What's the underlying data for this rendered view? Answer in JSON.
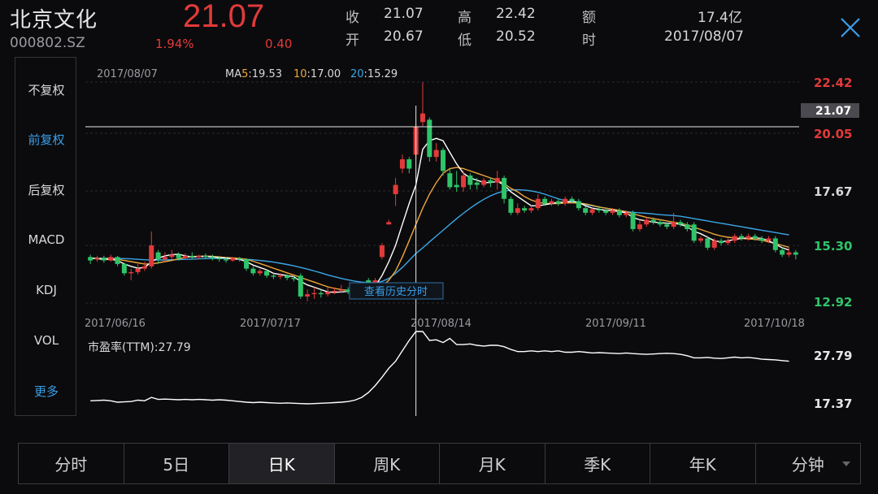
{
  "header": {
    "name": "北京文化",
    "code": "000802.SZ",
    "price": "21.07",
    "change_pct": "1.94%",
    "change_abs": "0.40",
    "quote": [
      {
        "label": "收",
        "value": "21.07"
      },
      {
        "label": "高",
        "value": "22.42"
      },
      {
        "label": "额",
        "value": "17.4亿"
      },
      {
        "label": "开",
        "value": "20.67"
      },
      {
        "label": "低",
        "value": "20.52"
      },
      {
        "label": "时",
        "value": "2017/08/07"
      }
    ]
  },
  "side_panel": {
    "items": [
      "不复权",
      "前复权",
      "后复权",
      "MACD",
      "KDJ",
      "VOL",
      "更多"
    ],
    "active_index": 1
  },
  "kline": {
    "date": "2017/08/07",
    "ma": {
      "label": "MA",
      "ma5_period": "5",
      "ma5_value": ":19.53",
      "ma10_period": "10",
      "ma10_value": ":17.00",
      "ma20_period": "20",
      "ma20_value": ":15.29"
    },
    "price_axis": [
      "22.42",
      "20.05",
      "17.67",
      "15.30",
      "12.92"
    ],
    "crosshair_price": "21.07",
    "date_axis": [
      "2017/06/16",
      "2017/07/17",
      "2017/08/14",
      "2017/09/11",
      "2017/10/18"
    ],
    "history_button": "查看历史分时"
  },
  "pe": {
    "label": "市盈率(TTM):27.79",
    "axis": [
      "27.79",
      "17.37"
    ]
  },
  "tabs": {
    "items": [
      "分时",
      "5日",
      "日K",
      "周K",
      "月K",
      "季K",
      "年K",
      "分钟"
    ],
    "active_index": 2
  },
  "colors": {
    "up": "#e23a3a",
    "down": "#2fc46a",
    "ma5": "#ffffff",
    "ma10": "#f0a63a",
    "ma20": "#3aa6e6",
    "accent": "#3a9ee8"
  },
  "chart_data": {
    "type": "candlestick",
    "price_range": [
      12.92,
      22.42
    ],
    "candles": [
      {
        "o": 14.9,
        "c": 14.75,
        "h": 15.0,
        "l": 14.6
      },
      {
        "o": 14.8,
        "c": 14.85,
        "h": 14.95,
        "l": 14.7
      },
      {
        "o": 14.85,
        "c": 14.75,
        "h": 14.95,
        "l": 14.65
      },
      {
        "o": 14.75,
        "c": 14.9,
        "h": 15.0,
        "l": 14.7
      },
      {
        "o": 14.9,
        "c": 14.6,
        "h": 14.95,
        "l": 14.5
      },
      {
        "o": 14.6,
        "c": 14.2,
        "h": 14.65,
        "l": 14.1
      },
      {
        "o": 14.2,
        "c": 14.25,
        "h": 14.4,
        "l": 13.9
      },
      {
        "o": 14.25,
        "c": 14.4,
        "h": 14.6,
        "l": 14.15
      },
      {
        "o": 14.4,
        "c": 14.5,
        "h": 14.7,
        "l": 14.3
      },
      {
        "o": 14.5,
        "c": 15.4,
        "h": 16.0,
        "l": 14.4
      },
      {
        "o": 15.1,
        "c": 14.8,
        "h": 15.2,
        "l": 14.6
      },
      {
        "o": 14.8,
        "c": 14.9,
        "h": 15.1,
        "l": 14.7
      },
      {
        "o": 14.9,
        "c": 15.0,
        "h": 15.2,
        "l": 14.8
      },
      {
        "o": 15.0,
        "c": 14.85,
        "h": 15.1,
        "l": 14.75
      },
      {
        "o": 14.85,
        "c": 14.95,
        "h": 15.05,
        "l": 14.8
      },
      {
        "o": 14.95,
        "c": 14.9,
        "h": 15.1,
        "l": 14.8
      },
      {
        "o": 14.9,
        "c": 14.95,
        "h": 15.0,
        "l": 14.8
      },
      {
        "o": 14.95,
        "c": 14.9,
        "h": 15.05,
        "l": 14.8
      },
      {
        "o": 14.9,
        "c": 14.85,
        "h": 15.0,
        "l": 14.75
      },
      {
        "o": 14.85,
        "c": 14.8,
        "h": 14.95,
        "l": 14.7
      },
      {
        "o": 14.8,
        "c": 14.75,
        "h": 14.9,
        "l": 14.65
      },
      {
        "o": 14.75,
        "c": 14.85,
        "h": 14.9,
        "l": 14.7
      },
      {
        "o": 14.85,
        "c": 14.8,
        "h": 14.9,
        "l": 14.7
      },
      {
        "o": 14.8,
        "c": 14.4,
        "h": 14.85,
        "l": 14.3
      },
      {
        "o": 14.4,
        "c": 14.2,
        "h": 14.5,
        "l": 14.1
      },
      {
        "o": 14.2,
        "c": 14.3,
        "h": 14.4,
        "l": 14.1
      },
      {
        "o": 14.3,
        "c": 14.1,
        "h": 14.35,
        "l": 14.0
      },
      {
        "o": 14.1,
        "c": 14.05,
        "h": 14.2,
        "l": 13.95
      },
      {
        "o": 14.05,
        "c": 14.1,
        "h": 14.2,
        "l": 13.95
      },
      {
        "o": 14.1,
        "c": 14.0,
        "h": 14.15,
        "l": 13.9
      },
      {
        "o": 14.0,
        "c": 13.95,
        "h": 14.1,
        "l": 13.85
      },
      {
        "o": 14.1,
        "c": 13.2,
        "h": 14.2,
        "l": 13.1
      },
      {
        "o": 13.2,
        "c": 13.3,
        "h": 13.5,
        "l": 13.0
      },
      {
        "o": 13.3,
        "c": 13.35,
        "h": 13.6,
        "l": 13.1
      },
      {
        "o": 13.35,
        "c": 13.3,
        "h": 13.5,
        "l": 13.15
      },
      {
        "o": 13.3,
        "c": 13.4,
        "h": 13.6,
        "l": 13.2
      },
      {
        "o": 13.4,
        "c": 13.45,
        "h": 13.6,
        "l": 13.3
      },
      {
        "o": 13.45,
        "c": 13.5,
        "h": 13.7,
        "l": 13.35
      },
      {
        "o": 13.5,
        "c": 13.4,
        "h": 13.6,
        "l": 13.3
      },
      {
        "o": 13.4,
        "c": 13.5,
        "h": 13.65,
        "l": 13.3
      },
      {
        "o": 13.5,
        "c": 13.45,
        "h": 13.6,
        "l": 13.35
      },
      {
        "o": 13.9,
        "c": 13.6,
        "h": 14.0,
        "l": 13.5
      },
      {
        "o": 13.6,
        "c": 13.9,
        "h": 14.0,
        "l": 13.5
      },
      {
        "o": 14.9,
        "c": 15.4,
        "h": 15.5,
        "l": 14.8
      },
      {
        "o": 16.3,
        "c": 16.4,
        "h": 16.5,
        "l": 16.3
      },
      {
        "o": 17.6,
        "c": 18.0,
        "h": 18.3,
        "l": 17.1
      },
      {
        "o": 18.7,
        "c": 19.1,
        "h": 19.3,
        "l": 18.5
      },
      {
        "o": 19.1,
        "c": 18.7,
        "h": 19.2,
        "l": 18.5
      },
      {
        "o": 19.3,
        "c": 20.5,
        "h": 20.6,
        "l": 19.1
      },
      {
        "o": 20.7,
        "c": 21.07,
        "h": 22.42,
        "l": 20.52
      },
      {
        "o": 20.8,
        "c": 19.2,
        "h": 20.9,
        "l": 19.0
      },
      {
        "o": 19.2,
        "c": 19.5,
        "h": 19.8,
        "l": 19.0
      },
      {
        "o": 19.5,
        "c": 18.6,
        "h": 19.6,
        "l": 18.4
      },
      {
        "o": 18.5,
        "c": 17.9,
        "h": 18.7,
        "l": 17.8
      },
      {
        "o": 18.0,
        "c": 17.9,
        "h": 18.6,
        "l": 17.7
      },
      {
        "o": 17.9,
        "c": 18.4,
        "h": 18.6,
        "l": 17.7
      },
      {
        "o": 18.4,
        "c": 18.0,
        "h": 18.5,
        "l": 17.8
      },
      {
        "o": 18.1,
        "c": 18.0,
        "h": 18.3,
        "l": 17.8
      },
      {
        "o": 18.0,
        "c": 18.2,
        "h": 18.3,
        "l": 17.9
      },
      {
        "o": 18.2,
        "c": 18.1,
        "h": 18.3,
        "l": 17.9
      },
      {
        "o": 18.1,
        "c": 18.3,
        "h": 18.6,
        "l": 17.8
      },
      {
        "o": 18.3,
        "c": 17.4,
        "h": 18.4,
        "l": 17.2
      },
      {
        "o": 17.4,
        "c": 16.8,
        "h": 17.5,
        "l": 16.7
      },
      {
        "o": 16.8,
        "c": 17.0,
        "h": 17.2,
        "l": 16.7
      },
      {
        "o": 17.0,
        "c": 16.9,
        "h": 17.1,
        "l": 16.8
      },
      {
        "o": 16.9,
        "c": 17.0,
        "h": 17.1,
        "l": 16.8
      },
      {
        "o": 17.0,
        "c": 17.4,
        "h": 17.6,
        "l": 16.9
      },
      {
        "o": 17.4,
        "c": 17.2,
        "h": 17.5,
        "l": 17.1
      },
      {
        "o": 17.2,
        "c": 17.3,
        "h": 17.4,
        "l": 17.1
      },
      {
        "o": 17.3,
        "c": 17.2,
        "h": 17.4,
        "l": 17.1
      },
      {
        "o": 17.2,
        "c": 17.4,
        "h": 17.5,
        "l": 17.1
      },
      {
        "o": 17.4,
        "c": 17.3,
        "h": 17.5,
        "l": 17.2
      },
      {
        "o": 17.3,
        "c": 17.0,
        "h": 17.4,
        "l": 16.9
      },
      {
        "o": 17.0,
        "c": 16.8,
        "h": 17.1,
        "l": 16.7
      },
      {
        "o": 16.8,
        "c": 16.95,
        "h": 17.0,
        "l": 16.7
      },
      {
        "o": 16.95,
        "c": 16.9,
        "h": 17.1,
        "l": 16.8
      },
      {
        "o": 16.9,
        "c": 16.8,
        "h": 17.0,
        "l": 16.7
      },
      {
        "o": 16.8,
        "c": 16.9,
        "h": 17.0,
        "l": 16.7
      },
      {
        "o": 16.9,
        "c": 16.7,
        "h": 17.0,
        "l": 16.6
      },
      {
        "o": 16.7,
        "c": 16.8,
        "h": 16.9,
        "l": 16.6
      },
      {
        "o": 16.8,
        "c": 16.1,
        "h": 16.9,
        "l": 16.0
      },
      {
        "o": 16.1,
        "c": 16.3,
        "h": 16.5,
        "l": 16.0
      },
      {
        "o": 16.3,
        "c": 16.5,
        "h": 16.6,
        "l": 16.2
      },
      {
        "o": 16.5,
        "c": 16.4,
        "h": 16.6,
        "l": 16.3
      },
      {
        "o": 16.4,
        "c": 16.3,
        "h": 16.5,
        "l": 16.2
      },
      {
        "o": 16.3,
        "c": 16.2,
        "h": 16.4,
        "l": 16.1
      },
      {
        "o": 16.2,
        "c": 16.4,
        "h": 16.8,
        "l": 16.1
      },
      {
        "o": 16.4,
        "c": 16.3,
        "h": 16.5,
        "l": 16.2
      },
      {
        "o": 16.3,
        "c": 16.1,
        "h": 16.4,
        "l": 16.0
      },
      {
        "o": 16.3,
        "c": 15.6,
        "h": 16.4,
        "l": 15.5
      },
      {
        "o": 15.6,
        "c": 15.7,
        "h": 15.8,
        "l": 15.5
      },
      {
        "o": 15.7,
        "c": 15.3,
        "h": 15.8,
        "l": 15.2
      },
      {
        "o": 15.3,
        "c": 15.6,
        "h": 15.7,
        "l": 15.2
      },
      {
        "o": 15.6,
        "c": 15.5,
        "h": 15.7,
        "l": 15.4
      },
      {
        "o": 15.5,
        "c": 15.6,
        "h": 15.7,
        "l": 15.4
      },
      {
        "o": 15.6,
        "c": 15.8,
        "h": 15.9,
        "l": 15.5
      },
      {
        "o": 15.8,
        "c": 15.7,
        "h": 15.9,
        "l": 15.6
      },
      {
        "o": 15.7,
        "c": 15.8,
        "h": 15.9,
        "l": 15.6
      },
      {
        "o": 15.8,
        "c": 15.7,
        "h": 15.9,
        "l": 15.6
      },
      {
        "o": 15.7,
        "c": 15.6,
        "h": 15.8,
        "l": 15.5
      },
      {
        "o": 15.6,
        "c": 15.7,
        "h": 15.8,
        "l": 15.5
      },
      {
        "o": 15.7,
        "c": 15.2,
        "h": 15.8,
        "l": 15.1
      },
      {
        "o": 15.2,
        "c": 15.0,
        "h": 15.3,
        "l": 14.9
      },
      {
        "o": 15.0,
        "c": 15.1,
        "h": 15.3,
        "l": 14.9
      },
      {
        "o": 15.1,
        "c": 15.0,
        "h": 15.2,
        "l": 14.8
      }
    ],
    "ma5": [
      14.85,
      14.82,
      14.8,
      14.8,
      14.75,
      14.6,
      14.5,
      14.42,
      14.45,
      14.7,
      14.85,
      14.95,
      15.0,
      15.02,
      14.95,
      14.9,
      14.92,
      14.93,
      14.9,
      14.88,
      14.85,
      14.82,
      14.8,
      14.7,
      14.55,
      14.45,
      14.35,
      14.2,
      14.15,
      14.1,
      14.05,
      13.85,
      13.7,
      13.6,
      13.5,
      13.4,
      13.38,
      13.4,
      13.42,
      13.45,
      13.47,
      13.55,
      13.65,
      14.1,
      14.7,
      15.4,
      16.3,
      17.2,
      18.0,
      19.53,
      19.9,
      20.0,
      19.9,
      19.4,
      18.9,
      18.5,
      18.3,
      18.2,
      18.1,
      18.1,
      18.15,
      18.0,
      17.7,
      17.5,
      17.3,
      17.1,
      17.1,
      17.15,
      17.2,
      17.25,
      17.25,
      17.3,
      17.25,
      17.1,
      17.0,
      16.95,
      16.9,
      16.9,
      16.85,
      16.8,
      16.6,
      16.5,
      16.45,
      16.4,
      16.38,
      16.35,
      16.35,
      16.3,
      16.2,
      16.0,
      15.9,
      15.75,
      15.6,
      15.55,
      15.6,
      15.65,
      15.7,
      15.72,
      15.72,
      15.7,
      15.6,
      15.45,
      15.3,
      15.2
    ],
    "ma10": [
      14.85,
      14.84,
      14.83,
      14.82,
      14.8,
      14.75,
      14.7,
      14.65,
      14.6,
      14.6,
      14.65,
      14.7,
      14.75,
      14.82,
      14.88,
      14.92,
      14.93,
      14.94,
      14.93,
      14.9,
      14.88,
      14.86,
      14.84,
      14.8,
      14.72,
      14.62,
      14.52,
      14.42,
      14.32,
      14.22,
      14.12,
      14.02,
      13.92,
      13.82,
      13.72,
      13.62,
      13.55,
      13.5,
      13.47,
      13.45,
      13.45,
      13.48,
      13.52,
      13.65,
      13.9,
      14.3,
      14.9,
      15.6,
      16.3,
      17.0,
      17.6,
      18.1,
      18.5,
      18.7,
      18.75,
      18.7,
      18.6,
      18.5,
      18.4,
      18.3,
      18.2,
      18.05,
      17.85,
      17.7,
      17.5,
      17.35,
      17.25,
      17.2,
      17.2,
      17.2,
      17.22,
      17.23,
      17.22,
      17.18,
      17.12,
      17.05,
      17.0,
      16.95,
      16.9,
      16.85,
      16.75,
      16.68,
      16.6,
      16.55,
      16.5,
      16.45,
      16.4,
      16.35,
      16.28,
      16.18,
      16.08,
      15.98,
      15.88,
      15.8,
      15.75,
      15.72,
      15.7,
      15.68,
      15.66,
      15.62,
      15.55,
      15.48,
      15.4,
      15.32
    ],
    "ma20": [
      14.85,
      14.85,
      14.85,
      14.84,
      14.84,
      14.83,
      14.82,
      14.8,
      14.78,
      14.77,
      14.77,
      14.77,
      14.78,
      14.79,
      14.8,
      14.81,
      14.82,
      14.83,
      14.84,
      14.84,
      14.84,
      14.83,
      14.82,
      14.8,
      14.78,
      14.75,
      14.72,
      14.68,
      14.63,
      14.58,
      14.52,
      14.45,
      14.38,
      14.3,
      14.22,
      14.13,
      14.05,
      13.98,
      13.92,
      13.86,
      13.82,
      13.8,
      13.8,
      13.85,
      13.98,
      14.2,
      14.45,
      14.75,
      15.05,
      15.29,
      15.55,
      15.8,
      16.05,
      16.3,
      16.55,
      16.78,
      17.0,
      17.2,
      17.38,
      17.53,
      17.65,
      17.73,
      17.78,
      17.79,
      17.78,
      17.74,
      17.68,
      17.6,
      17.5,
      17.4,
      17.32,
      17.25,
      17.2,
      17.15,
      17.1,
      17.05,
      17.0,
      16.95,
      16.9,
      16.85,
      16.82,
      16.8,
      16.78,
      16.75,
      16.72,
      16.7,
      16.68,
      16.65,
      16.6,
      16.55,
      16.5,
      16.45,
      16.4,
      16.35,
      16.3,
      16.25,
      16.2,
      16.15,
      16.1,
      16.05,
      16.0,
      15.95,
      15.9,
      15.85
    ],
    "crosshair_index": 48,
    "pe_range": [
      17.37,
      27.79
    ],
    "pe": [
      17.8,
      17.85,
      17.9,
      17.8,
      17.6,
      17.65,
      17.7,
      17.9,
      17.8,
      18.3,
      18.0,
      18.05,
      18.0,
      17.95,
      18.0,
      17.95,
      18.0,
      17.95,
      17.9,
      17.95,
      17.9,
      17.8,
      17.7,
      17.6,
      17.55,
      17.6,
      17.55,
      17.5,
      17.45,
      17.5,
      17.45,
      17.4,
      17.37,
      17.4,
      17.45,
      17.5,
      17.55,
      17.6,
      17.7,
      17.9,
      18.3,
      19.0,
      20.0,
      21.2,
      22.5,
      23.5,
      25.0,
      26.5,
      27.79,
      27.8,
      26.5,
      26.6,
      26.2,
      26.8,
      25.9,
      25.9,
      26.0,
      25.8,
      25.7,
      25.8,
      25.8,
      25.6,
      25.2,
      24.9,
      24.9,
      25.0,
      24.9,
      25.0,
      24.9,
      25.0,
      24.8,
      24.8,
      24.9,
      24.8,
      24.7,
      24.75,
      24.7,
      24.65,
      24.6,
      24.7,
      24.6,
      24.55,
      24.5,
      24.55,
      24.6,
      24.65,
      24.6,
      24.5,
      24.3,
      24.0,
      24.0,
      24.05,
      23.95,
      23.9,
      24.0,
      24.1,
      24.0,
      24.05,
      23.95,
      23.8,
      23.75,
      23.7,
      23.6,
      23.5
    ]
  }
}
